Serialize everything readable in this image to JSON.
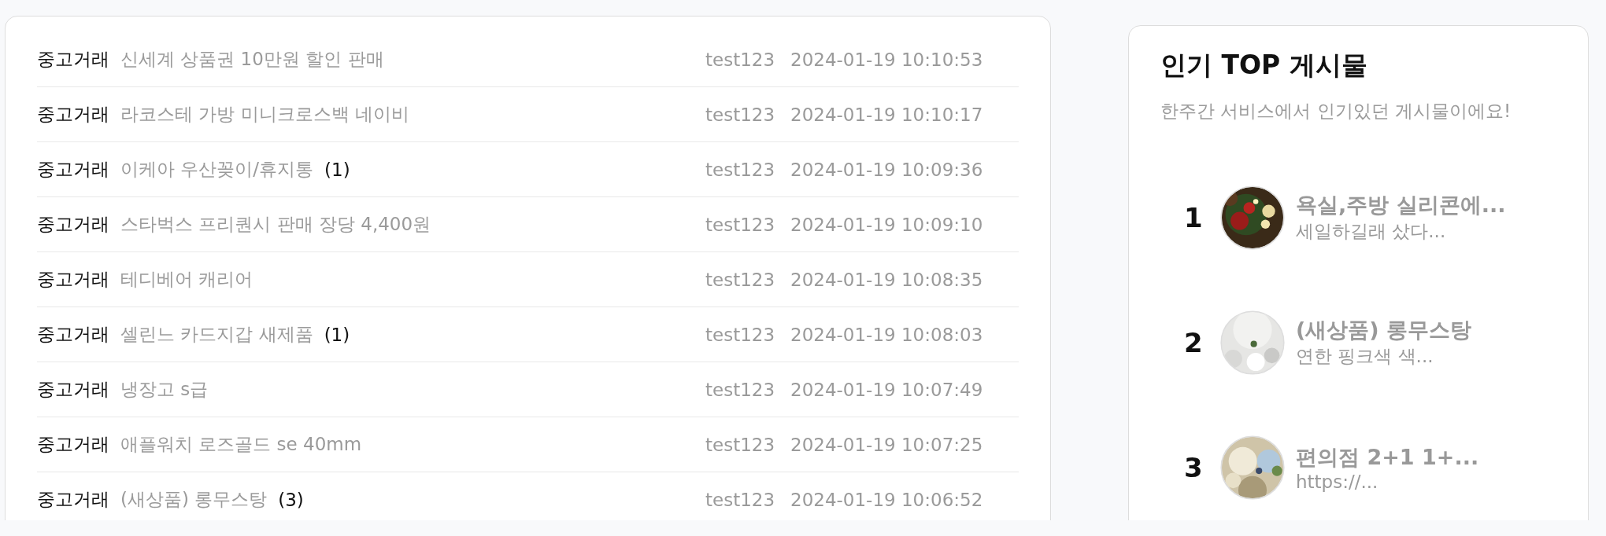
{
  "posts": [
    {
      "category": "중고거래",
      "title": "신세계 상품권 10만원 할인 판매",
      "author": "test123",
      "date": "2024-01-19 10:10:53"
    },
    {
      "category": "중고거래",
      "title": "라코스테 가방 미니크로스백 네이비",
      "author": "test123",
      "date": "2024-01-19 10:10:17"
    },
    {
      "category": "중고거래",
      "title": "이케아 우산꽂이/휴지통",
      "comments": "(1)",
      "author": "test123",
      "date": "2024-01-19 10:09:36"
    },
    {
      "category": "중고거래",
      "title": "스타벅스 프리퀀시 판매 장당 4,400원",
      "author": "test123",
      "date": "2024-01-19 10:09:10"
    },
    {
      "category": "중고거래",
      "title": "테디베어 캐리어",
      "author": "test123",
      "date": "2024-01-19 10:08:35"
    },
    {
      "category": "중고거래",
      "title": "셀린느 카드지갑 새제품",
      "comments": "(1)",
      "author": "test123",
      "date": "2024-01-19 10:08:03"
    },
    {
      "category": "중고거래",
      "title": "냉장고 s급",
      "author": "test123",
      "date": "2024-01-19 10:07:49"
    },
    {
      "category": "중고거래",
      "title": "애플워치 로즈골드 se 40mm",
      "author": "test123",
      "date": "2024-01-19 10:07:25"
    },
    {
      "category": "중고거래",
      "title": "(새상품) 롱무스탕",
      "comments": "(3)",
      "author": "test123",
      "date": "2024-01-19 10:06:52"
    }
  ],
  "popular": {
    "title": "인기 TOP 게시물",
    "subtitle": "한주간 서비스에서 인기있던 게시물이에요!",
    "items": [
      {
        "rank": "1",
        "title": "욕실,주방 실리콘에...",
        "excerpt": "세일하길래 샀다..."
      },
      {
        "rank": "2",
        "title": "(새상품) 롱무스탕",
        "excerpt": "연한 핑크색 색..."
      },
      {
        "rank": "3",
        "title": "편의점 2+1 1+...",
        "excerpt": "https://..."
      }
    ]
  }
}
